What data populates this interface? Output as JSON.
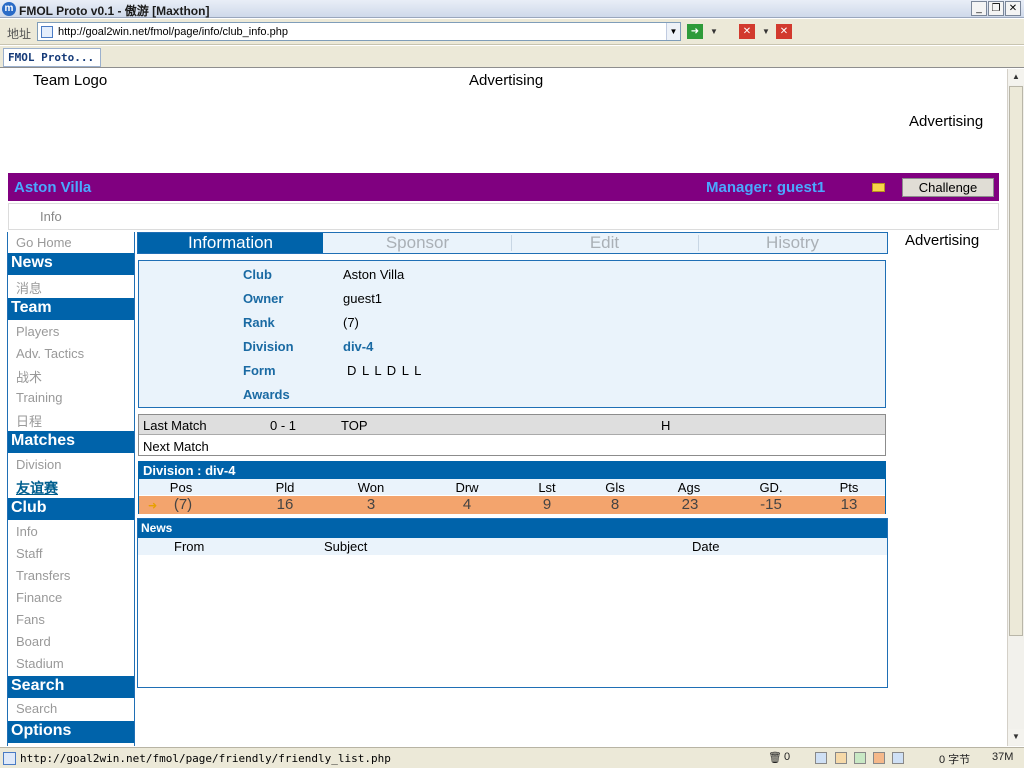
{
  "browser": {
    "title": "FMOL Proto v0.1 - 傲游 [Maxthon]",
    "address_label": "地址",
    "url": "http://goal2win.net/fmol/page/info/club_info.php",
    "tab_label": "FMOL Proto...",
    "status_url": "http://goal2win.net/fmol/page/friendly/friendly_list.php",
    "status_trash_count": "0",
    "status_bytes": "0 字节",
    "status_mem": "37M"
  },
  "header": {
    "team_logo": "Team Logo",
    "ad_top": "Advertising",
    "ad_right": "Advertising",
    "ad_side": "Advertising"
  },
  "club_bar": {
    "name": "Aston Villa",
    "manager": "Manager: guest1",
    "challenge": "Challenge"
  },
  "info_bar": {
    "label": "Info"
  },
  "sidebar": {
    "go_home": "Go Home",
    "news_head": "News",
    "news_msg": "消息",
    "team_head": "Team",
    "players": "Players",
    "adv_tactics": "Adv. Tactics",
    "tactics_cn": "战术",
    "training": "Training",
    "schedule_cn": "日程",
    "matches_head": "Matches",
    "division": "Division",
    "friendly_cn": "友谊赛",
    "club_head": "Club",
    "info": "Info",
    "staff": "Staff",
    "transfers": "Transfers",
    "finance": "Finance",
    "fans": "Fans",
    "board": "Board",
    "stadium": "Stadium",
    "search_head": "Search",
    "search": "Search",
    "options_head": "Options"
  },
  "tabs": [
    "Information",
    "Sponsor",
    "Edit",
    "Hisotry"
  ],
  "info": {
    "club_label": "Club",
    "club_value": "Aston Villa",
    "owner_label": "Owner",
    "owner_value": "guest1",
    "rank_label": "Rank",
    "rank_value": "(7)",
    "division_label": "Division",
    "division_value": "div-4",
    "form_label": "Form",
    "form_value": "D L L D L L",
    "awards_label": "Awards",
    "awards_value": ""
  },
  "matches": {
    "last_label": "Last Match",
    "last_score": "0 - 1",
    "last_opponent": "TOP",
    "last_venue": "H",
    "next_label": "Next Match"
  },
  "division_table": {
    "title": "Division : div-4",
    "columns": [
      "Pos",
      "Pld",
      "Won",
      "Drw",
      "Lst",
      "Gls",
      "Ags",
      "GD.",
      "Pts"
    ],
    "row": [
      "(7)",
      "16",
      "3",
      "4",
      "9",
      "8",
      "23",
      "-15",
      "13"
    ]
  },
  "news": {
    "title": "News",
    "columns": [
      "From",
      "Subject",
      "Date"
    ]
  }
}
